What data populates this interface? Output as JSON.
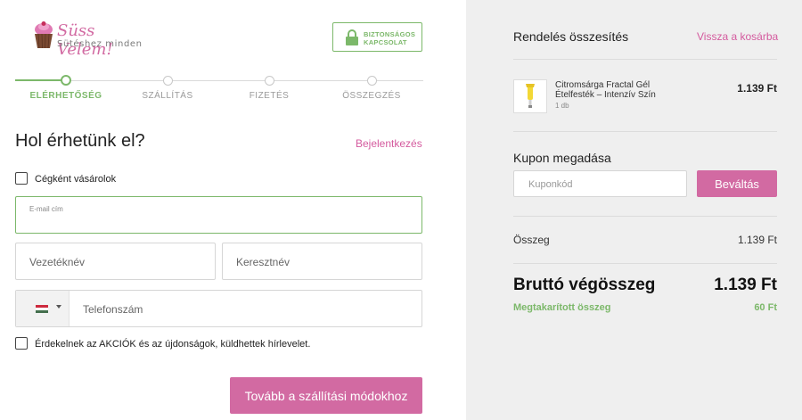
{
  "brand": {
    "name": "Süss Velem!",
    "tagline": "Sütéshez minden",
    "accent_color": "#d26aa2",
    "success_color": "#7cb86a"
  },
  "secure_badge": {
    "line1": "BIZTONSÁGOS",
    "line2": "KAPCSOLAT",
    "icon": "lock-icon"
  },
  "steps": [
    {
      "label": "ELÉRHETŐSÉG",
      "active": true
    },
    {
      "label": "SZÁLLÍTÁS",
      "active": false
    },
    {
      "label": "FIZETÉS",
      "active": false
    },
    {
      "label": "ÖSSZEGZÉS",
      "active": false
    }
  ],
  "form": {
    "title": "Hol érhetünk el?",
    "login_link": "Bejelentkezés",
    "company_checkbox": "Cégként vásárolok",
    "email_label": "E-mail cím",
    "email_value": "",
    "last_name_placeholder": "Vezetéknév",
    "first_name_placeholder": "Keresztnév",
    "phone_placeholder": "Telefonszám",
    "phone_country_icon": "hungary-flag-icon",
    "newsletter_checkbox": "Érdekelnek az AKCIÓK és az újdonságok, küldhettek hírlevelet.",
    "submit_label": "Tovább a szállítási módokhoz"
  },
  "summary": {
    "title": "Rendelés összesítés",
    "back_link": "Vissza a kosárba",
    "product": {
      "name": "Citromsárga Fractal Gél Ételfesték – Intenzív Szín",
      "qty": "1 db",
      "price": "1.139 Ft"
    },
    "coupon": {
      "title": "Kupon megadása",
      "placeholder": "Kuponkód",
      "button": "Beváltás"
    },
    "subtotal_label": "Összeg",
    "subtotal_value": "1.139 Ft",
    "total_label": "Bruttó végösszeg",
    "total_value": "1.139 Ft",
    "saved_label": "Megtakarított összeg",
    "saved_value": "60 Ft"
  }
}
